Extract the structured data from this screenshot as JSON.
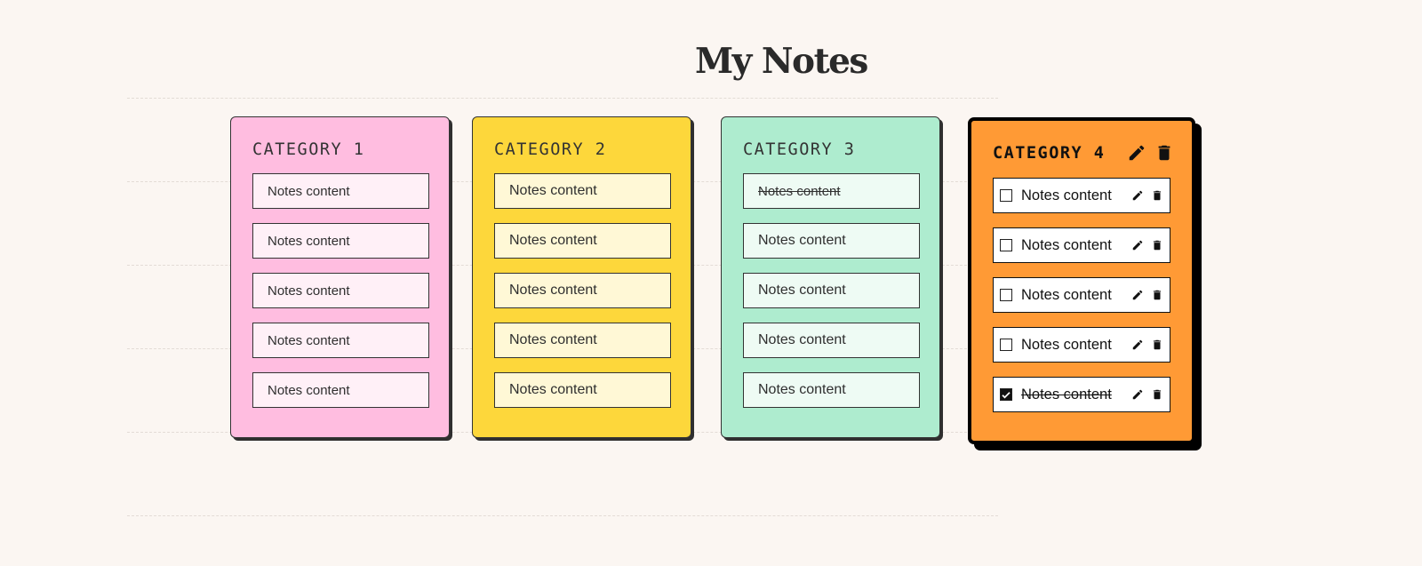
{
  "page": {
    "title": "My Notes"
  },
  "categories": [
    {
      "title": "CATEGORY 1",
      "notes": [
        {
          "text": "Notes content",
          "done": false
        },
        {
          "text": "Notes content",
          "done": false
        },
        {
          "text": "Notes content",
          "done": false
        },
        {
          "text": "Notes content",
          "done": false
        },
        {
          "text": "Notes content",
          "done": false
        }
      ]
    },
    {
      "title": "CATEGORY 2",
      "notes": [
        {
          "text": "Notes content",
          "done": false
        },
        {
          "text": "Notes content",
          "done": false
        },
        {
          "text": "Notes content",
          "done": false
        },
        {
          "text": "Notes content",
          "done": false
        },
        {
          "text": "Notes content",
          "done": false
        }
      ]
    },
    {
      "title": "CATEGORY 3",
      "notes": [
        {
          "text": "Notes content",
          "done": true
        },
        {
          "text": "Notes content",
          "done": false
        },
        {
          "text": "Notes content",
          "done": false
        },
        {
          "text": "Notes content",
          "done": false
        },
        {
          "text": "Notes content",
          "done": false
        }
      ]
    },
    {
      "title": "CATEGORY 4",
      "active": true,
      "header_icons": [
        "pencil-icon",
        "trash-icon"
      ],
      "notes": [
        {
          "text": "Notes content",
          "done": false
        },
        {
          "text": "Notes content",
          "done": false
        },
        {
          "text": "Notes content",
          "done": false
        },
        {
          "text": "Notes content",
          "done": false
        },
        {
          "text": "Notes content",
          "done": true
        }
      ]
    }
  ],
  "colors": {
    "background": "#fbf6f2",
    "category_1": "#ffbde0",
    "category_2": "#fdd73b",
    "category_3": "#aeeccf",
    "category_4": "#ff9a35"
  }
}
